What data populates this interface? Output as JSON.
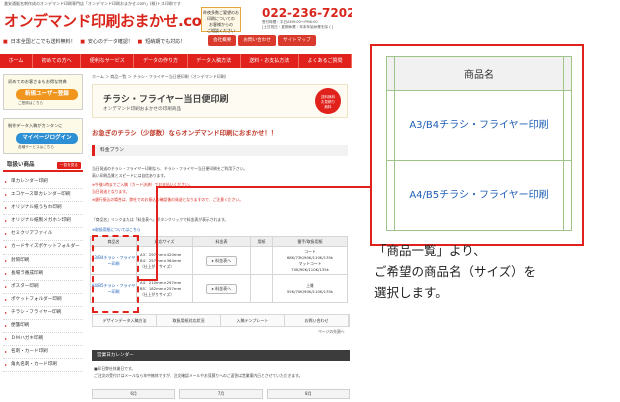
{
  "site": {
    "top_note": "激安通販名刺作成のオンデマンド印刷専門店「オンデマンド印刷おまかせ.com」(株)トス印刷です",
    "logo": "オンデマンド印刷おまかせ.com",
    "header_box": [
      "昨夜多数ご要望のお",
      "印刷についての",
      "お客様からの",
      "ご相談ください"
    ],
    "phone": "022-236-7202",
    "hours": [
      "受付時間：平日AM9:00〜PM6:00",
      "[土日祝日・夏期休業・年末年始休業を除く]"
    ],
    "features": [
      "日本全国どこでも送料無料！",
      "安心のデータ確認！",
      "短納期でも対応！"
    ],
    "header_buttons": [
      "会社概要",
      "お問い合わせ",
      "サイトマップ"
    ],
    "nav": [
      "ホーム",
      "初めての方へ",
      "便利なサービス",
      "データの作り方",
      "データ入稿方法",
      "送料・お支払方法",
      "よくあるご質問"
    ],
    "banners": [
      {
        "top": "初めてのお客さまもお得な特典",
        "button": "新規ユーザー登録",
        "sub": "ご登録はこちら"
      },
      {
        "top": "制作データ入稿がカンタンに",
        "button": "マイページログイン",
        "sub": "各種サービスはこちら"
      }
    ],
    "products_head": "取扱い商品",
    "products_all": "一覧を見る",
    "products": [
      "単カレンダー印刷",
      "エコケース単カレンダー印刷",
      "オリジナル紙うちわ印刷",
      "オリジナル紙製メガホン印刷",
      "セミクリアファイル",
      "カードサイズポケットフォルダー",
      "封筒印刷",
      "長場ラ番成印刷",
      "ポスター印刷",
      "ポケットフォルダー印刷",
      "チラシ・フライヤー印刷",
      "便箋印刷",
      "ＤＭハガキ印刷",
      "名刺・カード印刷",
      "角丸名刺・カード印刷"
    ],
    "breadcrumb": "ホーム ＞ 商品一覧 ＞ チラシ・フライヤー当日便印刷（オンデマンド印刷）",
    "page_banner_title": "チラシ・フライヤー当日便印刷",
    "page_banner_sub": "オンデマンド印刷おまかせの印刷商品",
    "page_banner_seal": [
      "送料無料",
      "お見積り",
      "無料"
    ],
    "lead": "お急ぎのチラシ（少部数）ならオンデマンド印刷におまかせ！！",
    "section_head": "料金プラン",
    "plan_text": [
      "当日発送のチラシ・フライヤー印刷なら、チラシ・フライヤー当日便印刷をご利用下さい。",
      "高い印刷品質とスピードには自信あります。",
      "※午後1時までご入稿（カード決済）でお支払いください。",
      "当日発送となります。",
      "※銀行振込の場合は、弊社でのお振込の確認後の発送となりますので、ご注意ください。"
    ],
    "plan_text2": "「商品名」リンクまたは「料金表へ」ボタンクリックで料金表が表示されます。",
    "plan_link": "※取扱用紙についてはこちら",
    "table_headers": [
      "商品名",
      "対応サイズ",
      "料金表",
      "用紙",
      "番手/取扱用紙"
    ],
    "table_rows": [
      {
        "name": "A3/B4チラシ・フライヤー印刷",
        "sizes": [
          "A3：297mm×420mm",
          "B4：257mm×364mm",
          "（仕上がりサイズ）"
        ],
        "price_button": "料金表へ",
        "paper": [
          "コート",
          "68K/73K/90K/110K/135k",
          "マットコート",
          "70K/90K/110K/135k"
        ]
      },
      {
        "name": "A4/B5チラシ・フライヤー印刷",
        "sizes": [
          "A4：210mm×297mm",
          "B5：182mm×257mm",
          "（仕上がりサイズ）"
        ],
        "price_button": "料金表へ",
        "paper": [
          "上質",
          "55K/70K/90K/110K/135k"
        ]
      }
    ],
    "link_row": [
      "デザインデータ入稿方法",
      "取扱用紙対応状況",
      "入稿テンプレート",
      "お問い合わせ"
    ],
    "page_top": "ページの先頭へ",
    "calendar_head": "営業日カレンダー",
    "calendar_notes": [
      "■印日弊社休業日です。",
      "ご注文の受付けはメールなら年中無休ですが、注文確認メールやお見積りへのご返答は営業案内日とさせていただきます。"
    ],
    "calendar_months": [
      "6月",
      "7月",
      "8月"
    ]
  },
  "zoom": {
    "header": "商品名",
    "items": [
      "A3/B4チラシ・フライヤー印刷",
      "A4/B5チラシ・フライヤー印刷"
    ]
  },
  "caption": [
    "「商品一覧」より、",
    "ご希望の商品名（サイズ）を",
    "選択します。"
  ],
  "colors": {
    "accent": "#e0211c",
    "link": "#1f5fb5",
    "cell_border": "#9ec48a"
  }
}
